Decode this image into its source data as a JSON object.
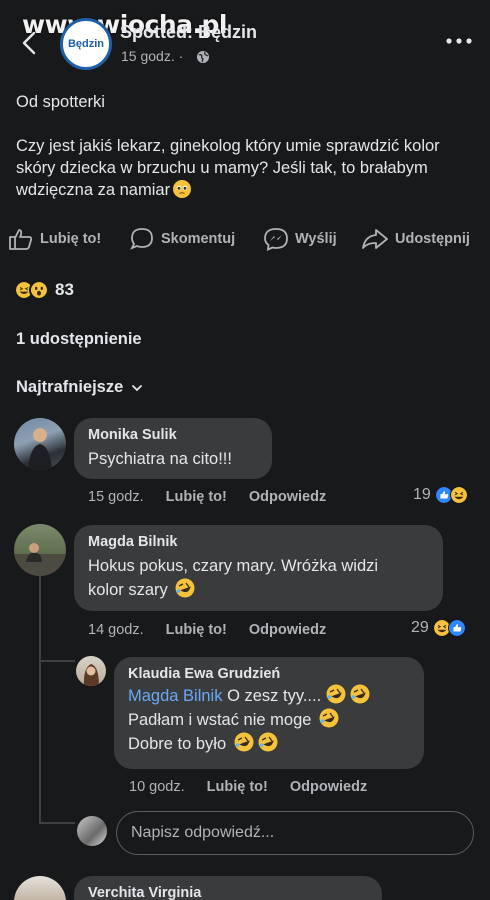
{
  "watermark": "www.wiocha.pl",
  "header": {
    "page_name": "Spotted: Będzin",
    "page_logo_text": "Będzin",
    "time": "15 godz. ·"
  },
  "post": {
    "line1": "Od spotterki",
    "body": "Czy jest jakiś lekarz, ginekolog który umie sprawdzić kolor skóry dziecka w brzuchu u mamy? Jeśli tak, to brałabym wdzięczna za namiar"
  },
  "actions": {
    "like": "Lubię to!",
    "comment": "Skomentuj",
    "send": "Wyślij",
    "share": "Udostępnij"
  },
  "reactions": {
    "count": "83"
  },
  "shares_text": "1 udostępnienie",
  "sort_label": "Najtrafniejsze",
  "comments": [
    {
      "author": "Monika Sulik",
      "text": "Psychiatra na cito!!!",
      "time": "15 godz.",
      "like": "Lubię to!",
      "reply": "Odpowiedz",
      "reactions": "19"
    },
    {
      "author": "Magda Bilnik",
      "text_line1": "Hokus pokus, czary mary. Wróżka widzi",
      "text_line2": "kolor szary",
      "time": "14 godz.",
      "like": "Lubię to!",
      "reply": "Odpowiedz",
      "reactions": "29"
    }
  ],
  "reply": {
    "author": "Klaudia Ewa Grudzień",
    "mention": "Magda Bilnik",
    "line1_rest": "O zesz tyy....",
    "line2": "Padłam i wstać nie moge",
    "line3": "Dobre to było",
    "time": "10 godz.",
    "like": "Lubię to!",
    "reply": "Odpowiedz"
  },
  "reply_placeholder": "Napisz odpowiedź...",
  "next_comment_author": "Verchita Virginia",
  "colors": {
    "background": "#18191a",
    "bubble": "#3a3b3c",
    "mention": "#6aa8f7",
    "like_blue": "#2d88ff",
    "emoji_yellow": "#f5c33b"
  }
}
